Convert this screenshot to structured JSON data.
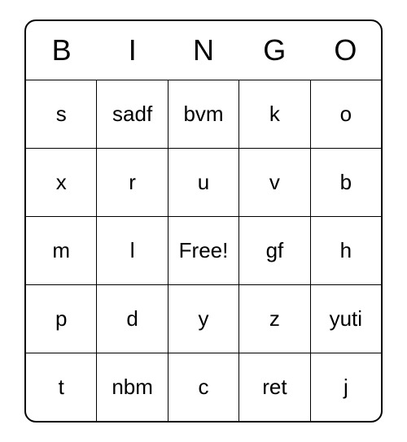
{
  "header": [
    "B",
    "I",
    "N",
    "G",
    "O"
  ],
  "grid": [
    [
      "s",
      "sadf",
      "bvm",
      "k",
      "o"
    ],
    [
      "x",
      "r",
      "u",
      "v",
      "b"
    ],
    [
      "m",
      "l",
      "Free!",
      "gf",
      "h"
    ],
    [
      "p",
      "d",
      "y",
      "z",
      "yuti"
    ],
    [
      "t",
      "nbm",
      "c",
      "ret",
      "j"
    ]
  ]
}
